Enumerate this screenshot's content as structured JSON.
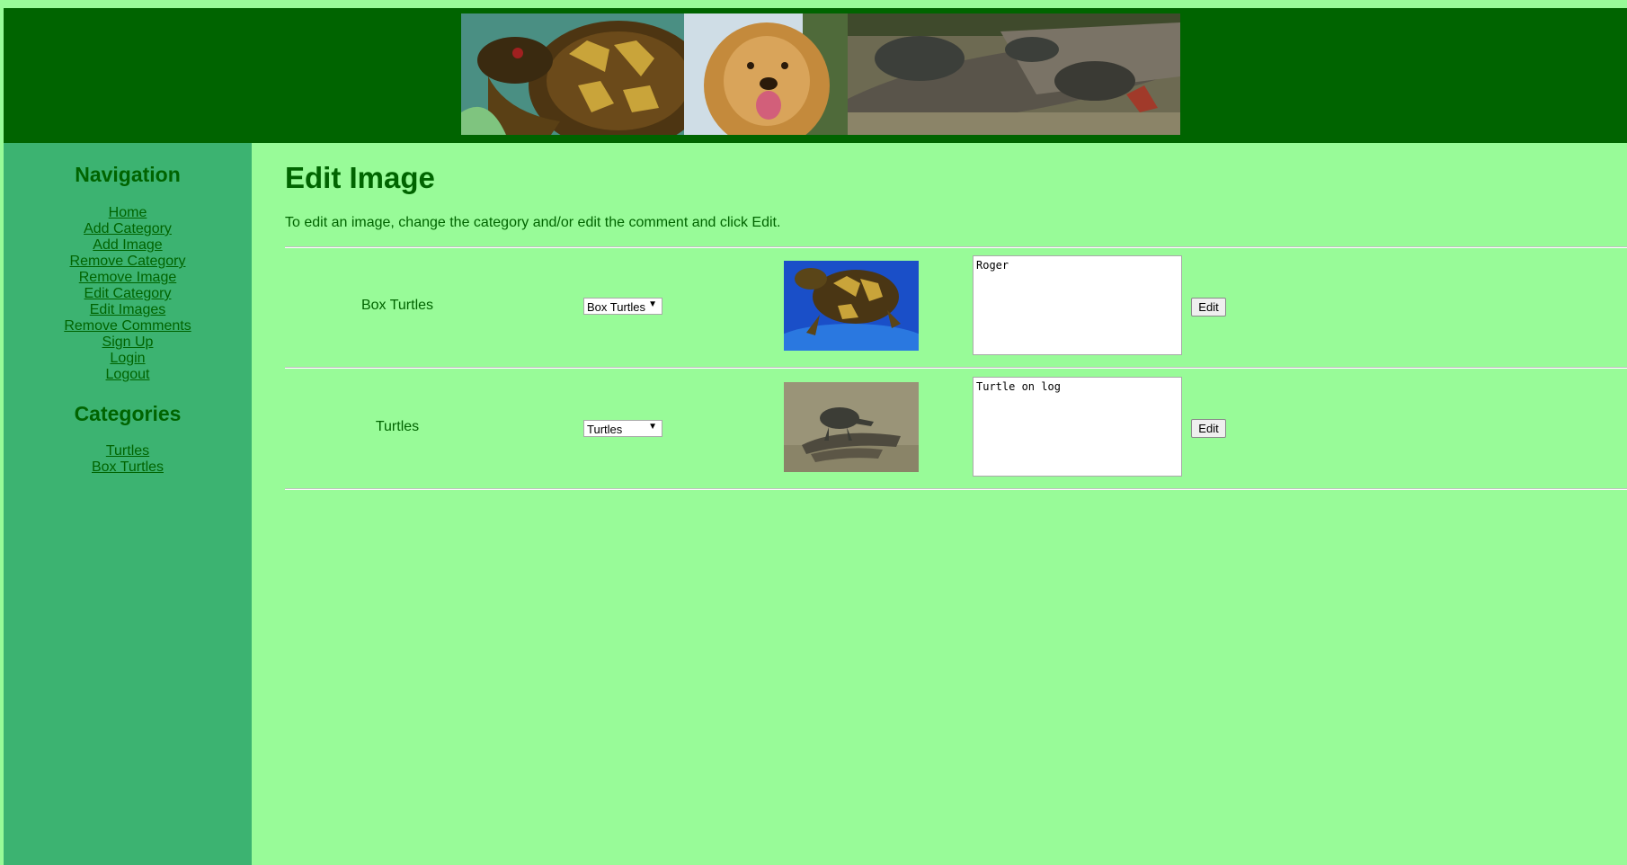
{
  "sidebar": {
    "nav_title": "Navigation",
    "nav_items": [
      "Home",
      "Add Category",
      "Add Image",
      "Remove Category",
      "Remove Image",
      "Edit Category",
      "Edit Images",
      "Remove Comments",
      "Sign Up",
      "Login",
      "Logout"
    ],
    "categories_title": "Categories",
    "categories": [
      "Turtles",
      "Box Turtles"
    ]
  },
  "main": {
    "title": "Edit Image",
    "intro": "To edit an image, change the category and/or edit the comment and click Edit.",
    "rows": [
      {
        "category": "Box Turtles",
        "selected": "Box Turtles",
        "comment": "Roger",
        "button": "Edit"
      },
      {
        "category": "Turtles",
        "selected": "Turtles",
        "comment": "Turtle on log",
        "button": "Edit"
      }
    ]
  },
  "colors": {
    "page_bg": "#98FB98",
    "header_bg": "#006400",
    "sidebar_bg": "#3CB371",
    "text": "#006400"
  }
}
